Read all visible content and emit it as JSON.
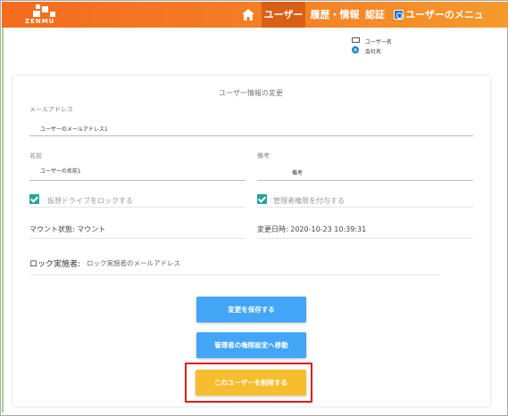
{
  "brand": {
    "logo_text": "ZENMU"
  },
  "nav": {
    "home_icon": "home-icon",
    "items": [
      {
        "label": "ユーザー",
        "active": true
      },
      {
        "label": "履歴・情報",
        "active": false
      },
      {
        "label": "認証",
        "active": false
      },
      {
        "label": "ユーザーのメニューへ",
        "active": false,
        "icon": "gear-icon"
      }
    ]
  },
  "legend": {
    "user_name": "ユーザー名",
    "company_name": "会社名"
  },
  "form": {
    "title": "ユーザー情報の変更",
    "email": {
      "label": "メールアドレス",
      "value": "ユーザーのメールアドレス1"
    },
    "name": {
      "label": "名前",
      "value": "ユーザーの名前1"
    },
    "note": {
      "label": "備考",
      "value": "備考"
    },
    "lock_drive": {
      "label": "仮想ドライブをロックする",
      "checked": true
    },
    "grant_admin": {
      "label": "管理者権限を付与する",
      "checked": true
    },
    "mount_status": "マウント状態: マウント",
    "modified_at": "変更日時: 2020-10-23 10:39:31",
    "lock_executor_label": "ロック実施者:",
    "lock_executor_value": "ロック実施者のメールアドレス"
  },
  "buttons": {
    "save": "変更を保存する",
    "admin_settings": "管理者の権限設定へ移動",
    "delete": "このユーザーを削除する"
  },
  "colors": {
    "nav_gradient_start": "#f46b1d",
    "nav_gradient_end": "#f59a2c",
    "button_blue": "#42a5f5",
    "button_yellow": "#f6bd2f",
    "checkbox": "#26a69a",
    "highlight": "#e3161c"
  }
}
